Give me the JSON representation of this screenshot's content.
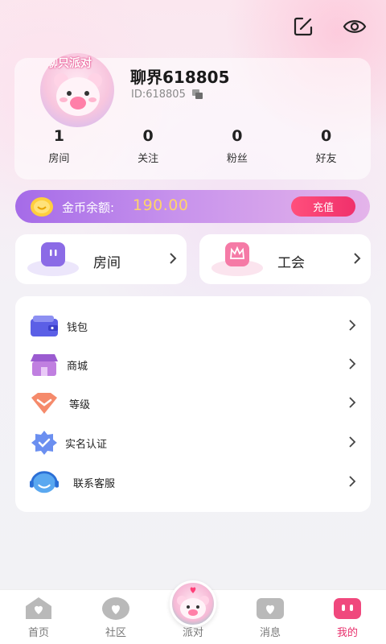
{
  "profile": {
    "nickname": "聊界618805",
    "id_text": "ID:618805",
    "avatar_logo": "聊只派对"
  },
  "stats": [
    {
      "num": "1",
      "label": "房间"
    },
    {
      "num": "0",
      "label": "关注"
    },
    {
      "num": "0",
      "label": "粉丝"
    },
    {
      "num": "0",
      "label": "好友"
    }
  ],
  "coins": {
    "label": "金币余额:",
    "value": "190.00",
    "recharge_label": "充值"
  },
  "quick": {
    "room_label": "房间",
    "guild_label": "工会"
  },
  "menu": [
    {
      "label": "钱包",
      "icon": "wallet-icon"
    },
    {
      "label": "商城",
      "icon": "shop-icon"
    },
    {
      "label": "等级",
      "icon": "level-icon"
    },
    {
      "label": "实名认证",
      "icon": "verify-icon"
    },
    {
      "label": "联系客服",
      "icon": "support-icon"
    }
  ],
  "tabs": [
    {
      "label": "首页",
      "icon": "home-icon",
      "active": false
    },
    {
      "label": "社区",
      "icon": "community-icon",
      "active": false
    },
    {
      "label": "派对",
      "icon": "party-icon",
      "active": false
    },
    {
      "label": "消息",
      "icon": "message-icon",
      "active": false
    },
    {
      "label": "我的",
      "icon": "me-icon",
      "active": true
    }
  ],
  "colors": {
    "accent": "#e8306c",
    "coin_value": "#ffd36b",
    "coin_bar_start": "#a56be8"
  }
}
